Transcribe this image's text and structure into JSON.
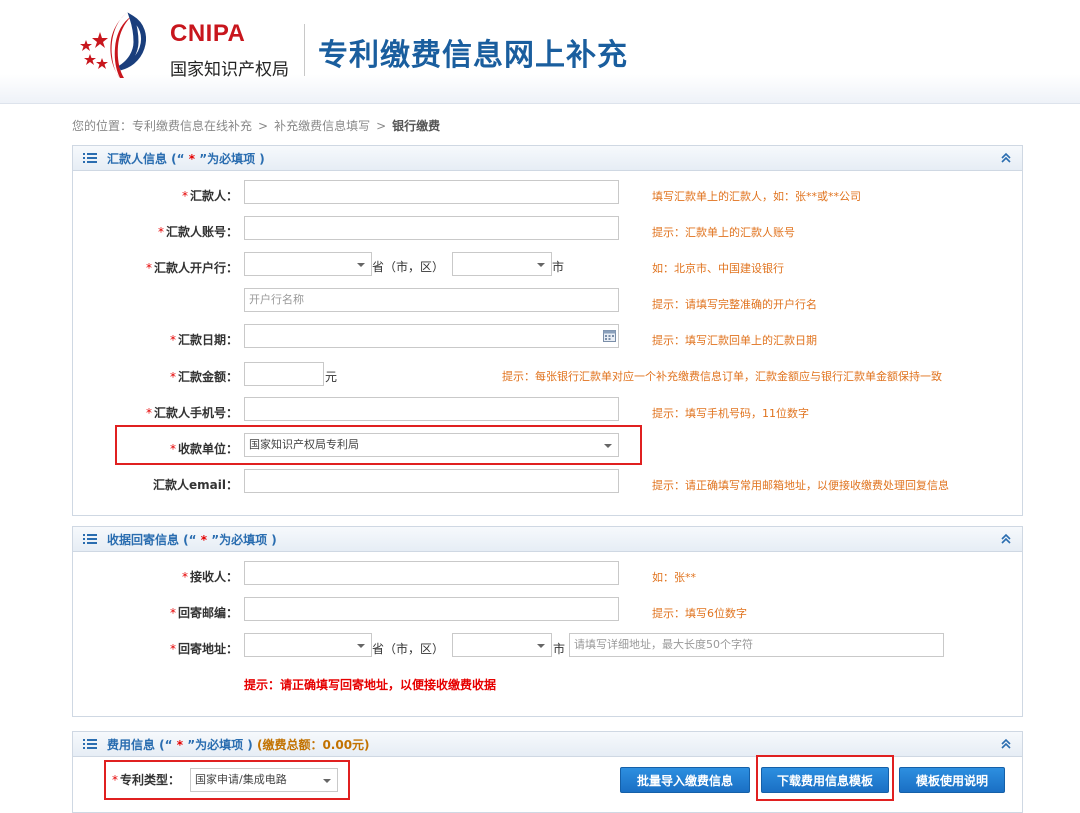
{
  "header": {
    "brand_en": "CNIPA",
    "brand_cn": "国家知识产权局",
    "site_title": "专利缴费信息网上补充"
  },
  "breadcrumb": {
    "prefix": "您的位置：",
    "items": [
      "专利缴费信息在线补充",
      "补充缴费信息填写",
      "银行缴费"
    ],
    "separator": ">"
  },
  "remitter_panel": {
    "title_prefix": "汇款人信息 (“",
    "title_star": " * ",
    "title_suffix": "”为必填项 )",
    "fields": {
      "remitter": {
        "label": "汇款人：",
        "value": "",
        "hint": "填写汇款单上的汇款人，如：张**或**公司"
      },
      "account": {
        "label": "汇款人账号：",
        "value": "",
        "hint": "提示：汇款单上的汇款人账号"
      },
      "bank": {
        "label": "汇款人开户行：",
        "province_value": "",
        "province_unit": "省（市，区）",
        "city_value": "",
        "city_unit": "市",
        "hint": "如：北京市、中国建设银行",
        "branch_placeholder": "开户行名称",
        "branch_hint": "提示：请填写完整准确的开户行名"
      },
      "date": {
        "label": "汇款日期：",
        "value": "",
        "hint": "提示：填写汇款回单上的汇款日期"
      },
      "amount": {
        "label": "汇款金额：",
        "value": "",
        "unit": "元",
        "hint": "提示：每张银行汇款单对应一个补充缴费信息订单，汇款金额应与银行汇款单金额保持一致"
      },
      "phone": {
        "label": "汇款人手机号：",
        "value": "",
        "hint": "提示：填写手机号码，11位数字"
      },
      "payee": {
        "label": "收款单位：",
        "value": "国家知识产权局专利局"
      },
      "email": {
        "label": "汇款人email：",
        "value": "",
        "hint": "提示：请正确填写常用邮箱地址，以便接收缴费处理回复信息"
      }
    }
  },
  "receipt_panel": {
    "title_prefix": "收据回寄信息 (“",
    "title_star": " * ",
    "title_suffix": "”为必填项 )",
    "fields": {
      "recipient": {
        "label": "接收人：",
        "value": "",
        "hint": "如：张**"
      },
      "postcode": {
        "label": "回寄邮编：",
        "value": "",
        "hint": "提示：填写6位数字"
      },
      "address": {
        "label": "回寄地址：",
        "province_value": "",
        "province_unit": "省（市，区）",
        "city_value": "",
        "city_unit": "市",
        "detail_placeholder": "请填写详细地址，最大长度50个字符",
        "hint": "提示：请正确填写回寄地址，以便接收缴费收据"
      }
    }
  },
  "fee_panel": {
    "title_prefix": "费用信息 (“",
    "title_star": " * ",
    "title_suffix": "”为必填项 )",
    "total_text": "(缴费总额：0.00元)",
    "patent_type_label": "专利类型：",
    "patent_type_value": "国家申请/集成电路",
    "buttons": {
      "batch_import": "批量导入缴费信息",
      "download_template": "下载费用信息模板",
      "template_help": "模板使用说明"
    }
  },
  "colors": {
    "brand_red": "#c8161d",
    "title_blue": "#1a5e9e",
    "hint_orange": "#e0731e",
    "required_red": "#e60000",
    "button_blue": "#1a6fc4"
  }
}
